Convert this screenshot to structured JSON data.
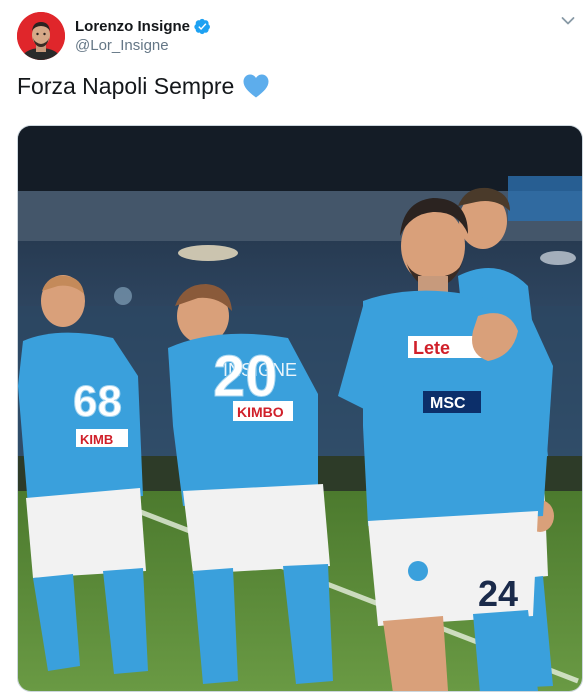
{
  "tweet": {
    "author": {
      "display_name": "Lorenzo Insigne",
      "handle": "@Lor_Insigne",
      "verified": true,
      "verified_icon": "verified-badge-icon",
      "avatar_color": "#e0262b"
    },
    "text": "Forza Napoli Sempre",
    "emoji_icon": "blue-heart-icon",
    "menu_icon": "chevron-down-icon",
    "media": {
      "kit_color": "#3aa0dc",
      "shorts_color": "#f2f2f2",
      "pitch_color": "#5a8a3a",
      "jersey_numbers": [
        "68",
        "20",
        "24"
      ],
      "sponsor": "MSC",
      "sleeve_sponsor": "KIMBO",
      "sponsor_front": "Lete"
    },
    "colors": {
      "text": "#14171a",
      "secondary": "#657786",
      "verified": "#1da1f2",
      "heart": "#5dadec"
    }
  }
}
